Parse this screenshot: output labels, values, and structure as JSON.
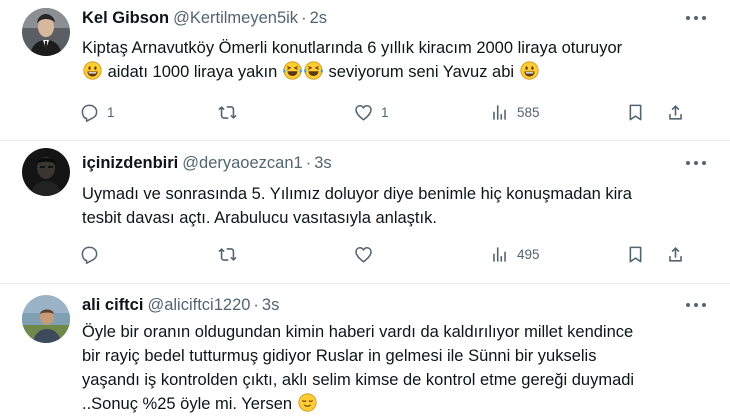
{
  "tweets": [
    {
      "name": "Kel Gibson",
      "handle": "@Kertilmeyen5ik",
      "separator": "·",
      "time": "2s",
      "text_line1": "Kiptaş Arnavutköy Ömerli konutlarında 6 yıllık kiracım 2000 liraya oturuyor",
      "text_seg1": "aidatı 1000 liraya yakın",
      "text_seg2": "seviyorum seni Yavuz abi",
      "emojis": [
        "grinning-emoji",
        "tears-of-joy-emoji",
        "tears-of-joy-emoji",
        "grinning-emoji"
      ],
      "replies": "1",
      "retweets": "",
      "likes": "1",
      "views": "585"
    },
    {
      "name": "içinizdenbiri",
      "handle": "@deryaoezcan1",
      "separator": "·",
      "time": "3s",
      "text_line1": "Uymadı ve sonrasında 5. Yılımız doluyor diye benimle hiç konuşmadan kira",
      "text_line2": "tesbit davası açtı.  Arabulucu vasıtasıyla anlaştık.",
      "replies": "",
      "retweets": "",
      "likes": "",
      "views": "495"
    },
    {
      "name": "ali ciftci",
      "handle": "@aliciftci1220",
      "separator": "·",
      "time": "3s",
      "text_line1": "Öyle bir oranın oldugundan kimin haberi vardı da kaldırılıyor millet kendince",
      "text_line2": "bir rayiç bedel tutturmuş gidiyor Ruslar in gelmesi ile Sünni bir yukselis",
      "text_line3": "yaşandı iş kontrolden çıktı, aklı selim kimse de kontrol etme gereği duymadi",
      "text_line4": "..Sonuç %25  öyle mi. Yersen",
      "emojis": [
        "relieved-face-emoji"
      ]
    }
  ],
  "icons": {
    "reply": "reply-icon",
    "retweet": "retweet-icon",
    "like": "heart-icon",
    "views": "views-icon",
    "bookmark": "bookmark-icon",
    "share": "share-icon",
    "more": "more-icon"
  },
  "colors": {
    "text": "#0f1419",
    "secondary": "#536471",
    "divider": "#e6eaed",
    "emoji": "#ffcc33"
  }
}
